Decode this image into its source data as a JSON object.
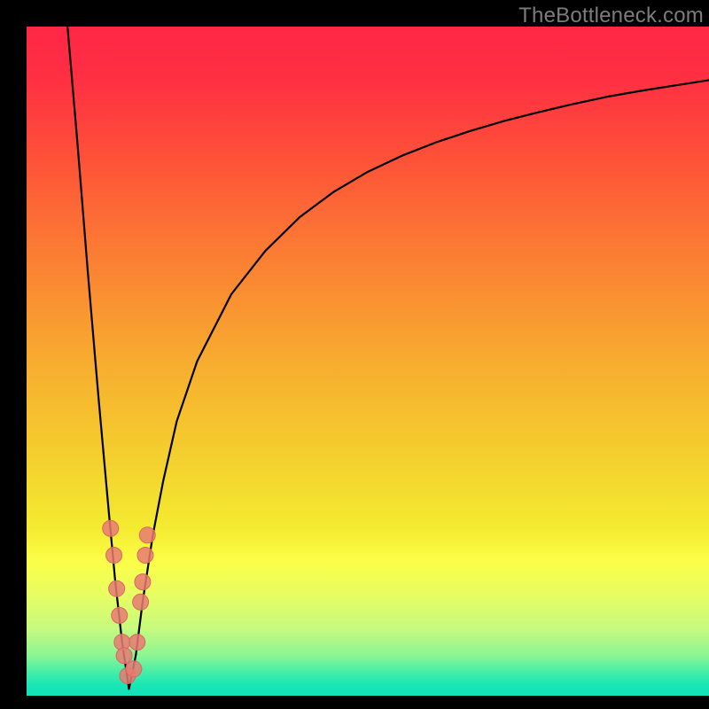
{
  "watermark": "TheBottleneck.com",
  "colors": {
    "frame": "#000000",
    "curve_stroke": "#000000",
    "dot_fill": "#E77A73",
    "dot_stroke": "#DA675F",
    "gradient_stops": [
      {
        "offset": 0.0,
        "color": "#FF2646"
      },
      {
        "offset": 0.08,
        "color": "#FF3042"
      },
      {
        "offset": 0.2,
        "color": "#FE5238"
      },
      {
        "offset": 0.35,
        "color": "#FB8033"
      },
      {
        "offset": 0.5,
        "color": "#F7AC2F"
      },
      {
        "offset": 0.65,
        "color": "#F4D12E"
      },
      {
        "offset": 0.75,
        "color": "#F4EB30"
      },
      {
        "offset": 0.8,
        "color": "#FBFE48"
      },
      {
        "offset": 0.85,
        "color": "#E7FD62"
      },
      {
        "offset": 0.9,
        "color": "#C6FA7E"
      },
      {
        "offset": 0.94,
        "color": "#8CF594"
      },
      {
        "offset": 0.965,
        "color": "#44EEA8"
      },
      {
        "offset": 0.985,
        "color": "#17E6B5"
      },
      {
        "offset": 1.0,
        "color": "#13E1BB"
      }
    ]
  },
  "chart_data": {
    "type": "line",
    "title": "",
    "xlabel": "",
    "ylabel": "",
    "xlim": [
      0,
      100
    ],
    "ylim": [
      0,
      100
    ],
    "notes": "Bottleneck-style V curve. x≈15 is the minimum (near 0). Left branch rises steeply to y≈100 at x≈6. Right branch rises with decreasing slope toward y≈92 at x=100. Scatter dots cluster on both branches near the trough (y roughly 2–25).",
    "series": [
      {
        "name": "curve",
        "x": [
          6.0,
          7.5,
          9.0,
          10.5,
          12.0,
          13.0,
          14.0,
          15.0,
          16.0,
          17.0,
          18.5,
          20.0,
          22.0,
          25.0,
          30.0,
          35.0,
          40.0,
          45.0,
          50.0,
          55.0,
          60.0,
          65.0,
          70.0,
          75.0,
          80.0,
          85.0,
          90.0,
          95.0,
          100.0
        ],
        "y": [
          100.0,
          82.0,
          63.0,
          45.0,
          28.0,
          17.0,
          8.0,
          1.0,
          6.0,
          14.0,
          24.0,
          32.0,
          41.0,
          50.0,
          60.0,
          66.5,
          71.5,
          75.3,
          78.3,
          80.7,
          82.7,
          84.4,
          85.9,
          87.2,
          88.4,
          89.5,
          90.4,
          91.2,
          92.0
        ]
      },
      {
        "name": "dots",
        "x": [
          12.3,
          12.8,
          13.2,
          13.6,
          14.0,
          14.3,
          14.8,
          15.7,
          16.2,
          16.7,
          17.0,
          17.4,
          17.7
        ],
        "y": [
          25.0,
          21.0,
          16.0,
          12.0,
          8.0,
          6.0,
          3.0,
          4.0,
          8.0,
          14.0,
          17.0,
          21.0,
          24.0
        ]
      }
    ]
  }
}
